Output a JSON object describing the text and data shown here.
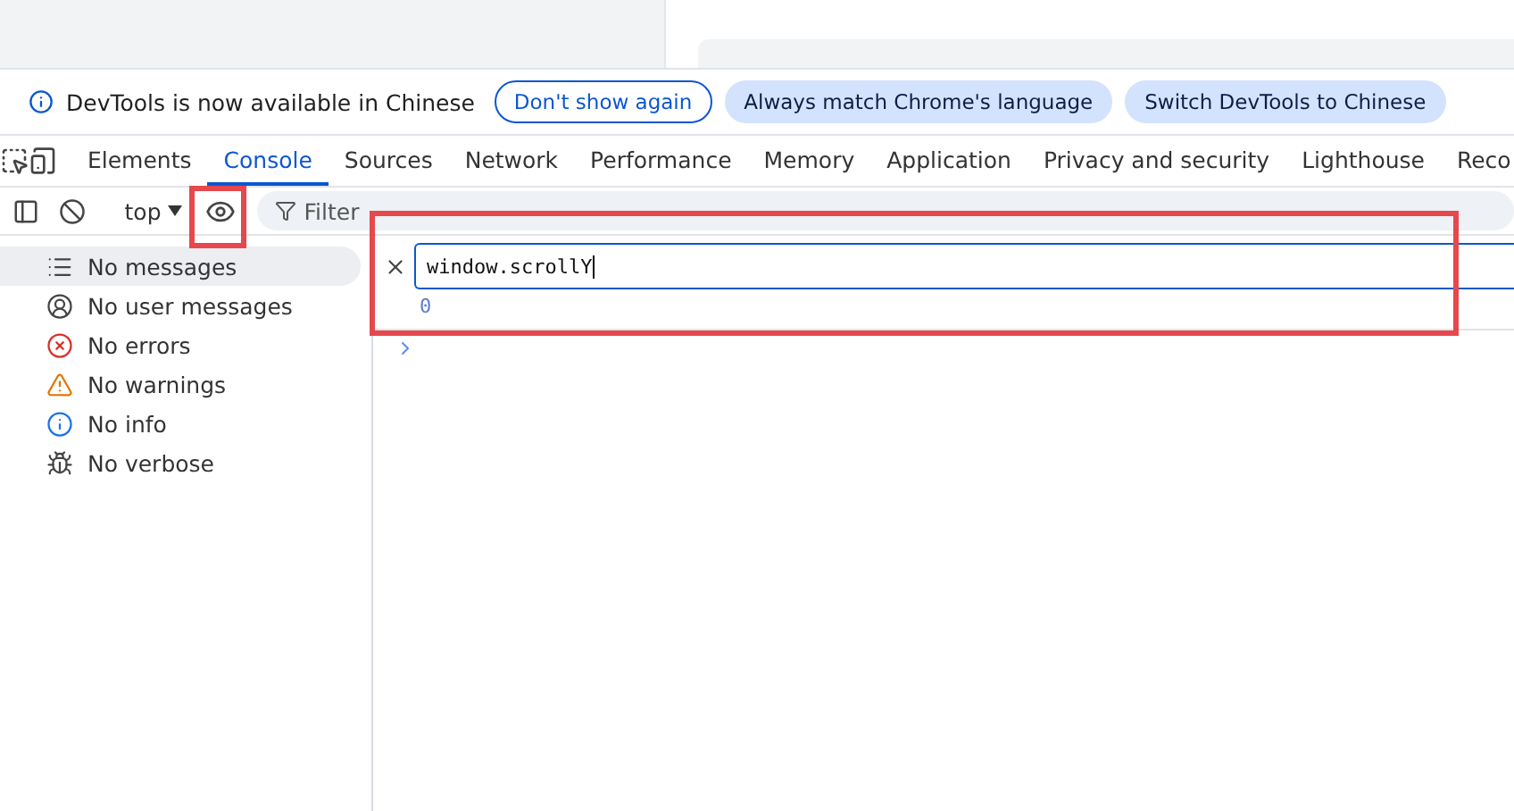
{
  "infobar": {
    "message": "DevTools is now available in Chinese",
    "buttons": [
      {
        "label": "Don't show again",
        "kind": "outline"
      },
      {
        "label": "Always match Chrome's language",
        "kind": "filled"
      },
      {
        "label": "Switch DevTools to Chinese",
        "kind": "filled"
      }
    ]
  },
  "tabs": [
    {
      "label": "Elements",
      "selected": false
    },
    {
      "label": "Console",
      "selected": true
    },
    {
      "label": "Sources",
      "selected": false
    },
    {
      "label": "Network",
      "selected": false
    },
    {
      "label": "Performance",
      "selected": false
    },
    {
      "label": "Memory",
      "selected": false
    },
    {
      "label": "Application",
      "selected": false
    },
    {
      "label": "Privacy and security",
      "selected": false
    },
    {
      "label": "Lighthouse",
      "selected": false
    },
    {
      "label": "Reco",
      "selected": false
    }
  ],
  "toolbar": {
    "context": "top",
    "live_expression_highlighted": true,
    "filter_placeholder": "Filter"
  },
  "sidebar": {
    "items": [
      {
        "label": "No messages",
        "kind": "list",
        "selected": true
      },
      {
        "label": "No user messages",
        "kind": "user",
        "selected": false
      },
      {
        "label": "No errors",
        "kind": "error",
        "selected": false
      },
      {
        "label": "No warnings",
        "kind": "warning",
        "selected": false
      },
      {
        "label": "No info",
        "kind": "info",
        "selected": false
      },
      {
        "label": "No verbose",
        "kind": "verbose",
        "selected": false
      }
    ]
  },
  "live_expression": {
    "expression": "window.scrollY",
    "result": "0",
    "highlighted": true
  }
}
